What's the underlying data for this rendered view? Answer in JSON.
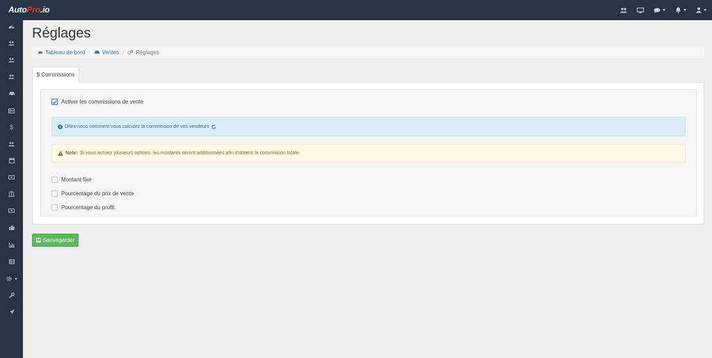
{
  "brand": {
    "part1": "Auto",
    "part2": "Pro",
    "part3": ".io"
  },
  "topbar": {
    "icons": [
      "users-icon",
      "monitor-icon",
      "comments-icon",
      "bell-icon",
      "user-icon"
    ]
  },
  "sidebar": {
    "icons": [
      "dashboard-icon",
      "users-icon",
      "users-icon",
      "users-icon",
      "car-icon",
      "list-icon",
      "dollar-icon",
      "users-icon",
      "calendar-icon",
      "money-icon",
      "bank-icon",
      "money-icon",
      "thumbs-up-icon",
      "bar-chart-icon",
      "table-icon",
      "gear-icon",
      "wrench-icon",
      "rocket-icon"
    ]
  },
  "page": {
    "title": "Réglages"
  },
  "breadcrumb": {
    "home": "Tableau de bord",
    "section": "Ventes",
    "current": "Réglages"
  },
  "tabs": {
    "commissions": "$ Commissions"
  },
  "form": {
    "enable_label": "Activer les commissions de vente",
    "enable_checked": true,
    "info_text": "Dites-nous comment vous calculez la commission de vos vendeurs",
    "warn_label": "Note:",
    "warn_text": "Si vous activez plusieurs options, les montants seront additionnées afin d'obtenir la commission totale",
    "options": [
      {
        "label": "Montant fixe",
        "checked": false
      },
      {
        "label": "Pourcentage du prix de vente",
        "checked": false
      },
      {
        "label": "Pourcentage du profit",
        "checked": false
      }
    ]
  },
  "actions": {
    "save_label": "Sauvegarder"
  },
  "colors": {
    "navbar": "#263445",
    "primary_link": "#3a78b5",
    "success": "#5cb85c",
    "info_bg": "#d9edf7",
    "warn_bg": "#fcf8e3"
  }
}
